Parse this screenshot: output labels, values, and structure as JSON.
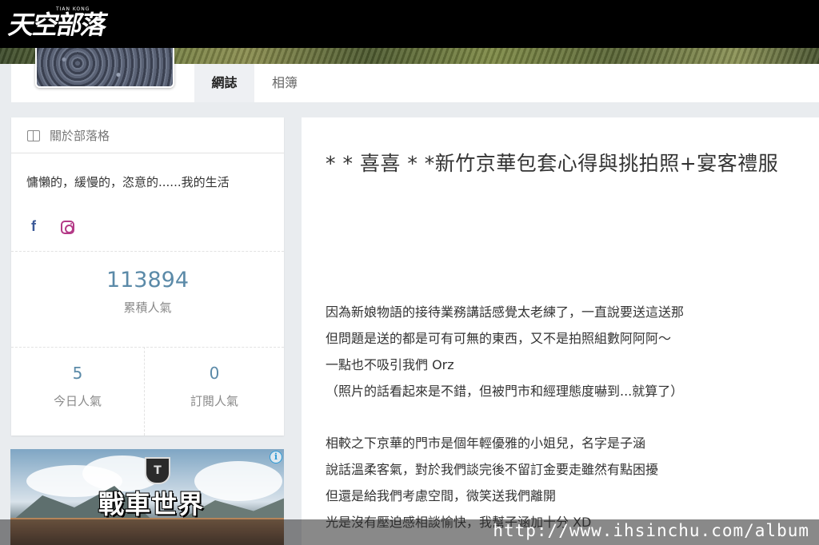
{
  "header": {
    "logo_text": "天空部落",
    "logo_small": "TIAN KONG"
  },
  "tabs": [
    {
      "label": "網誌",
      "active": true
    },
    {
      "label": "相簿",
      "active": false
    }
  ],
  "sidebar": {
    "about_title": "關於部落格",
    "description": "慵懶的，緩慢的，恣意的......我的生活",
    "social": {
      "facebook": "f"
    },
    "stats": {
      "total": {
        "value": "113894",
        "label": "累積人氣"
      },
      "today": {
        "value": "5",
        "label": "今日人氣"
      },
      "subscribe": {
        "value": "0",
        "label": "訂閱人氣"
      }
    }
  },
  "ad": {
    "title": "戰車世界",
    "info": "i"
  },
  "article": {
    "title": "* * 喜喜 * *新竹京華包套心得與挑拍照+宴客禮服",
    "paragraphs": [
      "因為新娘物語的接待業務講話感覺太老練了，一直說要送這送那",
      "但問題是送的都是可有可無的東西，又不是拍照組數阿阿阿～",
      "一點也不吸引我們 Orz",
      "（照片的話看起來是不錯，但被門市和經理態度嚇到...就算了）",
      "相較之下京華的門市是個年輕優雅的小姐兒，名字是子涵",
      "說話溫柔客氣，對於我們談完後不留訂金要走雖然有點困擾",
      "但還是給我們考慮空間，微笑送我們離開",
      "光是沒有壓迫感相談愉快，我幫子涵加十分 XD"
    ]
  },
  "watermark": "http://www.ihsinchu.com/album"
}
